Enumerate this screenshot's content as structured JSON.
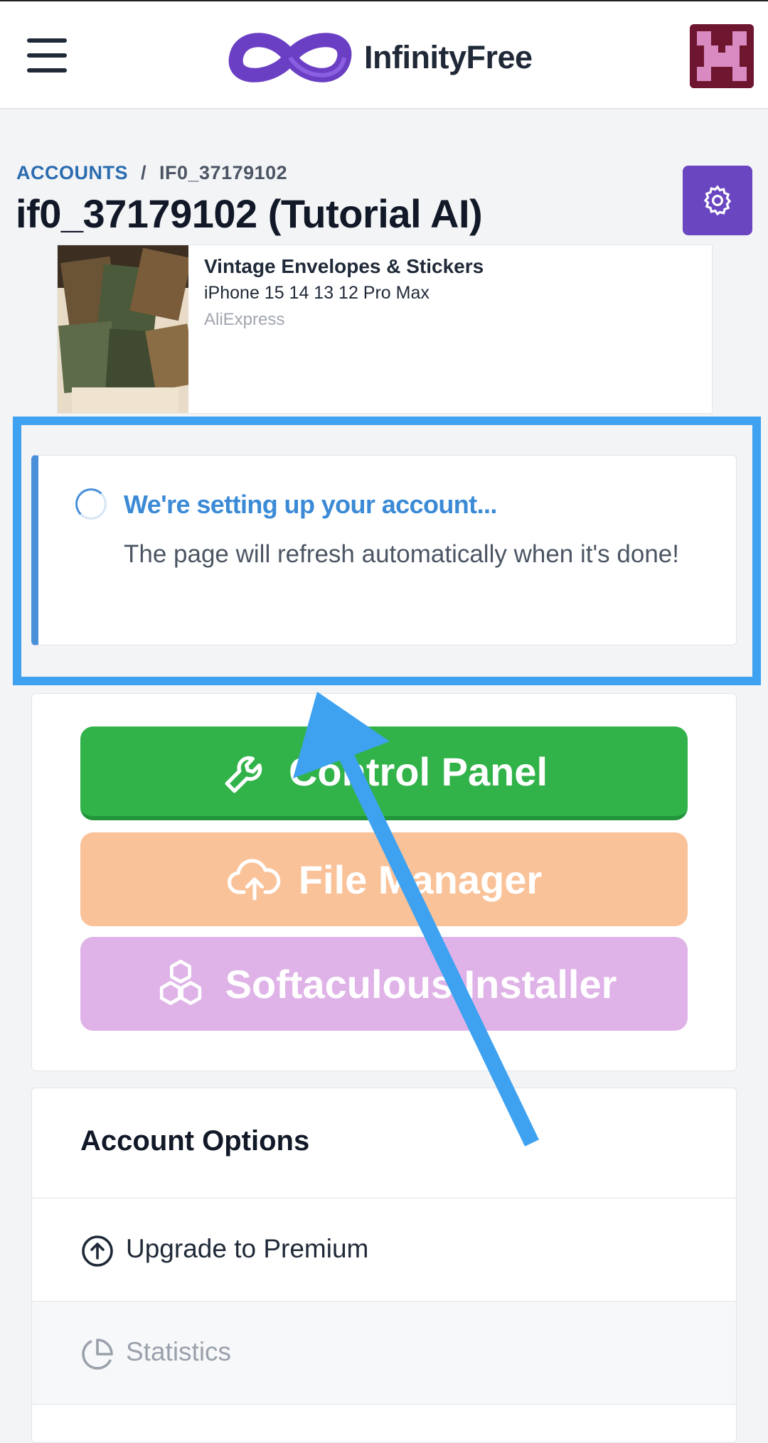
{
  "header": {
    "brand": "InfinityFree",
    "menu_icon": "hamburger-menu-icon",
    "logo_icon": "infinity-logo-icon",
    "avatar_icon": "pixel-avatar-icon"
  },
  "breadcrumb": {
    "parent": "ACCOUNTS",
    "separator": "/",
    "current": "IF0_37179102"
  },
  "page": {
    "title": "if0_37179102 (Tutorial AI)",
    "settings_icon": "gear-icon"
  },
  "ad": {
    "title": "Vintage Envelopes & Stickers",
    "subtitle": "iPhone 15 14 13 12 Pro Max",
    "source": "AliExpress"
  },
  "alert": {
    "title": "We're setting up your account...",
    "message": "The page will refresh automatically when it's done!",
    "icon": "spinner-icon"
  },
  "quick_actions": {
    "control_panel": "Control Panel",
    "file_manager": "File Manager",
    "softaculous": "Softaculous Installer"
  },
  "account_options": {
    "title": "Account Options",
    "items": [
      {
        "label": "Upgrade to Premium",
        "icon": "arrow-up-circle-icon",
        "enabled": true
      },
      {
        "label": "Statistics",
        "icon": "pie-chart-icon",
        "enabled": false
      }
    ]
  },
  "colors": {
    "brand_purple": "#6b46c1",
    "link_blue": "#2b6cb0",
    "alert_blue": "#4a90d9",
    "highlight_blue": "#3ea2f0",
    "control_panel_green": "#32b34a",
    "file_manager_orange": "#fac299",
    "softaculous_purple": "#dfb3e7"
  }
}
